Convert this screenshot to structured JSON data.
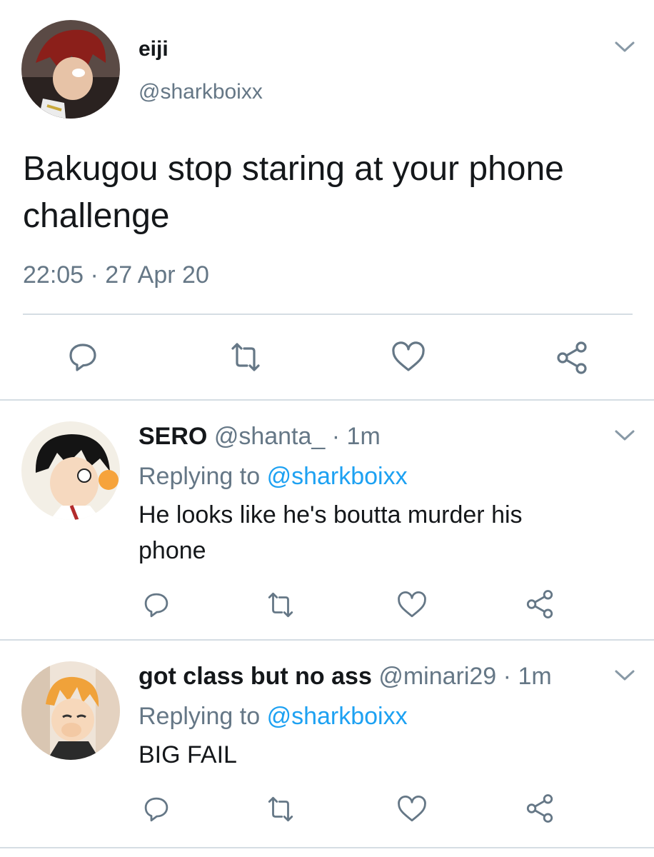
{
  "main_tweet": {
    "display_name": "eiji",
    "handle": "@sharkboixx",
    "text": "Bakugou stop staring at your phone challenge",
    "timestamp": "22:05 · 27 Apr 20"
  },
  "replies": [
    {
      "display_name": "SERO",
      "handle": "@shanta_",
      "time": "· 1m",
      "replying_prefix": "Replying to",
      "replying_to": "@sharkboixx",
      "text": "He looks like he's boutta murder his phone"
    },
    {
      "display_name": "got class but no ass",
      "handle": "@minari29",
      "time": "· 1m",
      "replying_prefix": "Replying to",
      "replying_to": "@sharkboixx",
      "text": "BIG FAIL"
    }
  ],
  "icons": {
    "reply": "reply-icon",
    "retweet": "retweet-icon",
    "like": "heart-icon",
    "share": "share-icon",
    "menu": "chevron-down-icon"
  },
  "colors": {
    "text": "#14171a",
    "muted": "#657786",
    "link": "#1da1f2",
    "divider": "#d5dde3"
  }
}
